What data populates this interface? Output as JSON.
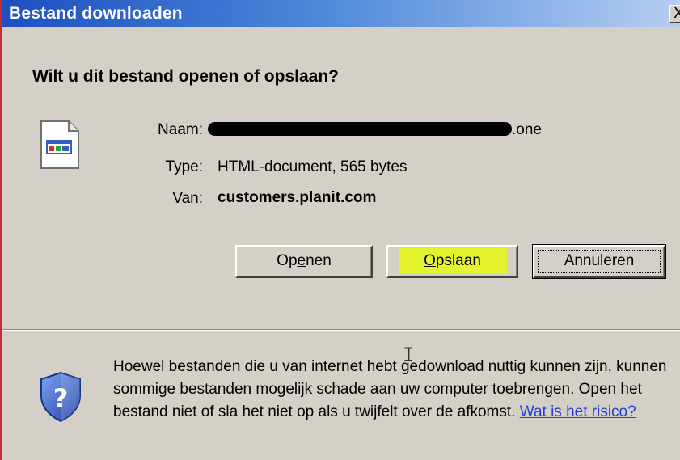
{
  "window": {
    "title": "Bestand downloaden",
    "close_symbol": "X"
  },
  "dialog": {
    "question": "Wilt u dit bestand openen of opslaan?",
    "file": {
      "icon": "html-document-icon",
      "name_label": "Naam:",
      "name_suffix": ".one",
      "type_label": "Type:",
      "type_value": "HTML-document, 565 bytes",
      "from_label": "Van:",
      "from_value": "customers.planit.com"
    },
    "buttons": {
      "open": {
        "prefix": "Op",
        "accel": "e",
        "suffix": "nen"
      },
      "save": {
        "prefix": "",
        "accel": "O",
        "suffix": "pslaan"
      },
      "cancel": "Annuleren"
    },
    "warning": {
      "text": "Hoewel bestanden die u van internet hebt gedownload nuttig kunnen zijn, kunnen sommige bestanden mogelijk schade aan uw computer toebrengen. Open het bestand niet of sla het niet op als u twijfelt over de afkomst. ",
      "link": "Wat is het risico?",
      "icon": "shield-question-icon"
    }
  },
  "colors": {
    "title_gradient_start": "#1d4fc2",
    "dialog_bg": "#d4d0c8",
    "highlight": "#e4f32e",
    "link": "#1f3fd8"
  }
}
